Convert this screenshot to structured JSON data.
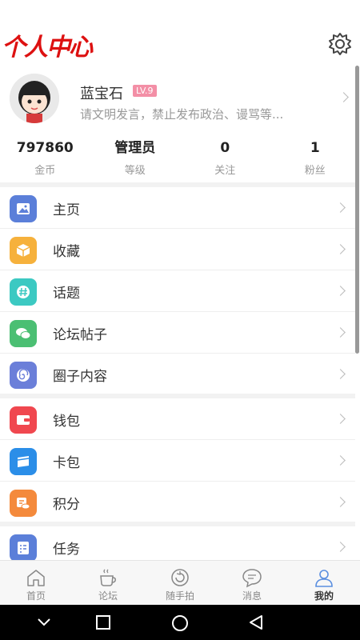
{
  "header": {
    "title": "个人中心",
    "settings_icon": "gear-icon"
  },
  "profile": {
    "name": "蓝宝石",
    "level": "LV.9",
    "signature": "请文明发言，禁止发布政治、谩骂等..."
  },
  "stats": [
    {
      "value": "797860",
      "label": "金币"
    },
    {
      "value": "管理员",
      "label": "等级"
    },
    {
      "value": "0",
      "label": "关注"
    },
    {
      "value": "1",
      "label": "粉丝"
    }
  ],
  "menu": [
    {
      "label": "主页",
      "icon": "image-icon",
      "color": "#5b7fd9"
    },
    {
      "label": "收藏",
      "icon": "box-icon",
      "color": "#f6b13c"
    },
    {
      "label": "话题",
      "icon": "hashtag-icon",
      "color": "#3cc9c2"
    },
    {
      "label": "论坛帖子",
      "icon": "chat-bubbles-icon",
      "color": "#4bbf73"
    },
    {
      "label": "圈子内容",
      "icon": "spiral-icon",
      "color": "#6b7fd9"
    },
    {
      "label": "钱包",
      "icon": "wallet-icon",
      "color": "#f0474f"
    },
    {
      "label": "卡包",
      "icon": "card-icon",
      "color": "#2b8ee8"
    },
    {
      "label": "积分",
      "icon": "coins-icon",
      "color": "#f48a3c"
    },
    {
      "label": "任务",
      "icon": "task-list-icon",
      "color": "#5b7fd9"
    }
  ],
  "tabs": [
    {
      "label": "首页",
      "icon": "home-icon"
    },
    {
      "label": "论坛",
      "icon": "coffee-cup-icon"
    },
    {
      "label": "随手拍",
      "icon": "refresh-camera-icon"
    },
    {
      "label": "消息",
      "icon": "message-icon"
    },
    {
      "label": "我的",
      "icon": "user-icon",
      "active": true
    }
  ],
  "colors": {
    "accent": "#5b8fe0",
    "title_red": "#dd1111"
  }
}
